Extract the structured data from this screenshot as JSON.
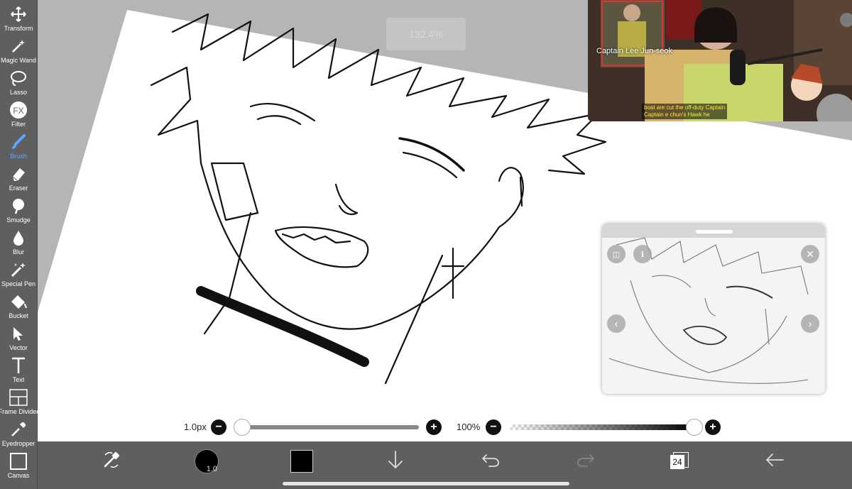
{
  "toolbar": {
    "items": [
      {
        "label": "Transform",
        "icon": "move-arrows-icon"
      },
      {
        "label": "Magic Wand",
        "icon": "magic-wand-icon"
      },
      {
        "label": "Lasso",
        "icon": "lasso-icon"
      },
      {
        "label": "Filter",
        "icon": "fx-icon"
      },
      {
        "label": "Brush",
        "icon": "brush-icon",
        "active": true
      },
      {
        "label": "Eraser",
        "icon": "eraser-icon"
      },
      {
        "label": "Smudge",
        "icon": "smudge-icon"
      },
      {
        "label": "Blur",
        "icon": "blur-drop-icon"
      },
      {
        "label": "Special Pen",
        "icon": "special-pen-icon"
      },
      {
        "label": "Bucket",
        "icon": "bucket-icon"
      },
      {
        "label": "Vector",
        "icon": "vector-arrow-icon"
      },
      {
        "label": "Text",
        "icon": "text-icon"
      },
      {
        "label": "Frame Divider",
        "icon": "frame-divider-icon"
      },
      {
        "label": "Eyedropper",
        "icon": "eyedropper-icon"
      },
      {
        "label": "Canvas",
        "icon": "canvas-icon"
      }
    ],
    "active_color": "#5aa8ff"
  },
  "canvas": {
    "zoom": "132.4%"
  },
  "video": {
    "name_caption": "Captain Lee Jun-seok",
    "subtitle_line1": "boat are cut the off-duty Captain",
    "subtitle_line2": "Captain e chun's Hawk he"
  },
  "brush_size": {
    "value": "1.0px",
    "minus": "−",
    "plus": "+",
    "level": 0.0
  },
  "opacity": {
    "value": "100%",
    "minus": "−",
    "plus": "+",
    "level": 1.0
  },
  "bottom_toolbar": {
    "brush_indicator": "1.0",
    "layer_count": "24",
    "color": "#000000"
  }
}
